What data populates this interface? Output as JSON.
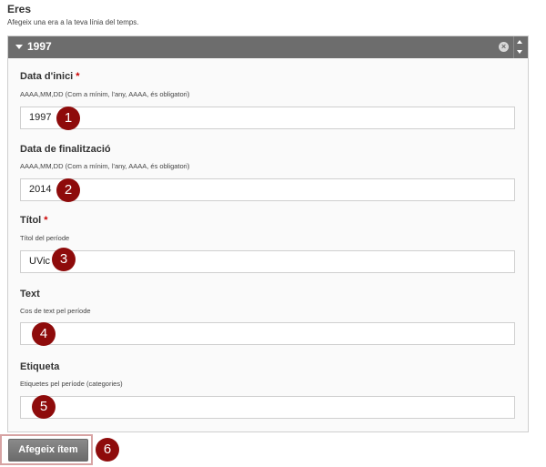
{
  "section": {
    "title": "Eres",
    "help": "Afegeix una era a la teva línia del temps."
  },
  "panel": {
    "title": "1997",
    "remove_icon": "close-circle-icon",
    "move_up_icon": "chevron-up-icon",
    "move_down_icon": "chevron-down-icon"
  },
  "fields": {
    "start_date": {
      "label": "Data d'inici",
      "required": "*",
      "help": "AAAA,MM,DD (Com a mínim, l'any, AAAA, és obligatori)",
      "value": "1997"
    },
    "end_date": {
      "label": "Data de finalització",
      "help": "AAAA,MM,DD (Com a mínim, l'any, AAAA, és obligatori)",
      "value": "2014"
    },
    "title": {
      "label": "Títol",
      "required": "*",
      "help": "Títol del període",
      "value": "UVic"
    },
    "text": {
      "label": "Text",
      "help": "Cos de text pel període",
      "value": ""
    },
    "tag": {
      "label": "Etiqueta",
      "help": "Etiquetes pel període (categories)",
      "value": ""
    }
  },
  "markers": [
    "1",
    "2",
    "3",
    "4",
    "5",
    "6"
  ],
  "actions": {
    "add_item_label": "Afegeix ítem"
  },
  "colors": {
    "marker": "#8e0b0b",
    "header": "#6d6d6d",
    "required": "#cc0000"
  }
}
